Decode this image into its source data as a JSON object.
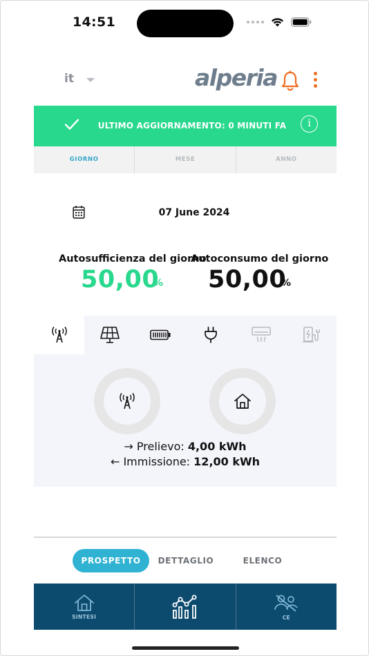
{
  "status_bar": {
    "time": "14:51"
  },
  "header": {
    "language": "it",
    "brand": "alperia",
    "accent_color": "#ef6b1e",
    "icons": [
      "chevron-down-icon",
      "bell-icon",
      "more-vertical-icon"
    ]
  },
  "banner": {
    "text": "ULTIMO AGGIORNAMENTO: 0 MINUTI FA",
    "info": "i",
    "color": "#28d88d"
  },
  "period_tabs": [
    {
      "label": "GIORNO",
      "active": true
    },
    {
      "label": "MESE",
      "active": false
    },
    {
      "label": "ANNO",
      "active": false
    }
  ],
  "date": "07 June 2024",
  "kpis": {
    "self_sufficiency": {
      "label": "Autosufficienza del giorno",
      "value": "50,00",
      "unit": "%"
    },
    "self_consumption": {
      "label": "Autoconsumo del giorno",
      "value": "50,00",
      "unit": "%"
    }
  },
  "device_tabs": [
    {
      "icon": "grid-tower-icon",
      "active": true
    },
    {
      "icon": "solar-panel-icon",
      "active": false
    },
    {
      "icon": "battery-icon",
      "active": false
    },
    {
      "icon": "plug-icon",
      "active": false
    },
    {
      "icon": "air-conditioner-icon",
      "active": false,
      "disabled": true
    },
    {
      "icon": "ev-charger-icon",
      "active": false,
      "disabled": true
    }
  ],
  "flows": {
    "withdrawal": {
      "label": "Prelievo:",
      "value": "4,00 kWh"
    },
    "injection": {
      "label": "Immissione:",
      "value": "12,00 kWh"
    }
  },
  "view_tabs": [
    {
      "label": "PROSPETTO",
      "active": true
    },
    {
      "label": "DETTAGLIO",
      "active": false
    },
    {
      "label": "ELENCO",
      "active": false
    }
  ],
  "bottom_nav": [
    {
      "label": "SINTESI",
      "icon": "home-icon"
    },
    {
      "label": "",
      "icon": "analytics-chart-icon",
      "active": true
    },
    {
      "label": "CE",
      "icon": "community-icon"
    }
  ],
  "colors": {
    "nav_bg": "#0c4a6e",
    "accent_blue": "#30b3d3",
    "green": "#28d88d"
  }
}
